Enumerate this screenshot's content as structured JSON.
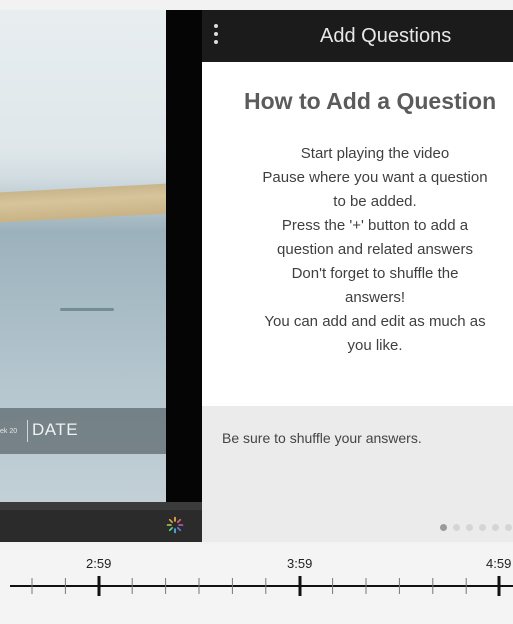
{
  "panel": {
    "title": "Add Questions",
    "heading": "How to Add a Question",
    "instructions": [
      "Start playing the video",
      "Pause where you want a question",
      "to be added.",
      "Press the '+' button to add a",
      "question and related answers",
      "Don't forget to shuffle the",
      "answers!",
      "You can add and edit as much as",
      "you like."
    ],
    "tip": "Be sure to shuffle your answers.",
    "pager": {
      "count": 6,
      "active_index": 0
    }
  },
  "video": {
    "overlay_week": "ek 20",
    "overlay_date": "DATE"
  },
  "timeline": {
    "labels": [
      "2:59",
      "3:59",
      "4:59"
    ]
  },
  "colors": {
    "header_bg": "#1b1b1b",
    "tip_bg": "#ebebeb",
    "player_bar": "#2b2b2b"
  }
}
